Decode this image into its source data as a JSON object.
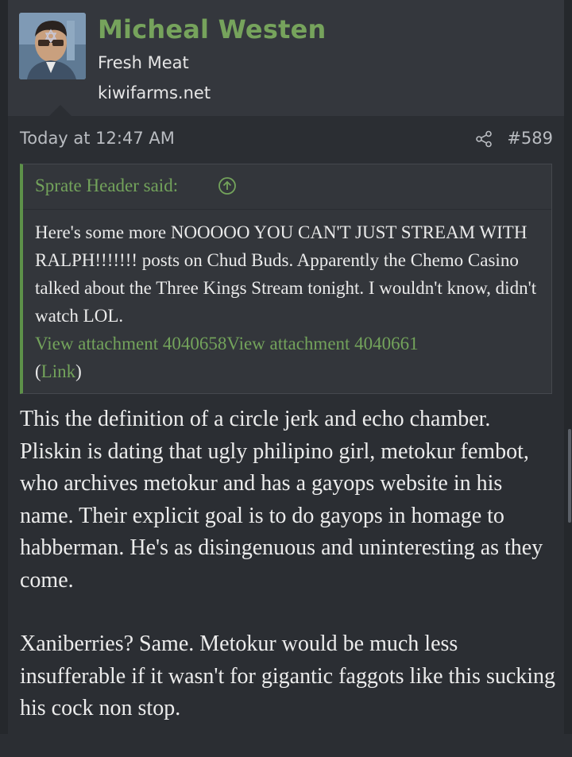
{
  "author": {
    "name": "Micheal Westen",
    "title": "Fresh Meat",
    "site": "kiwifarms.net"
  },
  "post": {
    "date": "Today at 12:47 AM",
    "number": "#589",
    "paragraphs": [
      "This the definition of a circle jerk and echo chamber. Pliskin is dating that ugly philipino girl, metokur fembot, who archives metokur and has a gayops website in his name. Their explicit goal is to do gayops in homage to habberman. He's as disingenuous and uninteresting as they come.",
      "Xaniberries? Same. Metokur would be much less insufferable if it wasn't for gigantic faggots like this sucking his cock non stop."
    ]
  },
  "quote": {
    "author_said": "Sprate Header said:",
    "text": "Here's some more NOOOOO YOU CAN'T JUST STREAM WITH RALPH!!!!!!! posts on Chud Buds. Apparently the Chemo Casino talked about the Three Kings Stream tonight. I wouldn't know, didn't watch LOL.",
    "attachment_1": "View attachment 4040658",
    "attachment_2": "View attachment 4040661",
    "link_open": "(",
    "link_label": "Link",
    "link_close": ")"
  },
  "icons": {
    "share": "share-icon",
    "goto": "arrow-up-circle-icon"
  },
  "colors": {
    "accent_green": "#76a35c",
    "background": "#2b2e33",
    "panel": "#34373d"
  }
}
